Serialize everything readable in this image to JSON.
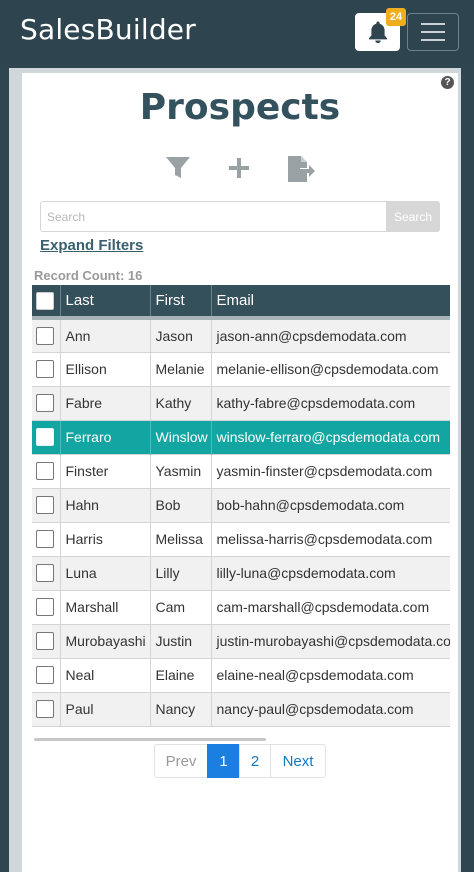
{
  "app": {
    "brand": "SalesBuilder",
    "notification_count": "24"
  },
  "page": {
    "title": "Prospects",
    "help": "?"
  },
  "toolbar": {
    "icons": [
      "filter-icon",
      "plus-icon",
      "export-icon"
    ]
  },
  "search": {
    "placeholder": "Search",
    "value": "",
    "button_label": "Search"
  },
  "filters": {
    "expand_label": "Expand Filters"
  },
  "record_count": "Record Count: 16",
  "table": {
    "columns": [
      "Last",
      "First",
      "Email"
    ],
    "rows": [
      {
        "last": "Ann",
        "first": "Jason",
        "email": "jason-ann@cpsdemodata.com",
        "selected": false
      },
      {
        "last": "Ellison",
        "first": "Melanie",
        "email": "melanie-ellison@cpsdemodata.com",
        "selected": false
      },
      {
        "last": "Fabre",
        "first": "Kathy",
        "email": "kathy-fabre@cpsdemodata.com",
        "selected": false
      },
      {
        "last": "Ferraro",
        "first": "Winslow",
        "email": "winslow-ferraro@cpsdemodata.com",
        "selected": true
      },
      {
        "last": "Finster",
        "first": "Yasmin",
        "email": "yasmin-finster@cpsdemodata.com",
        "selected": false
      },
      {
        "last": "Hahn",
        "first": "Bob",
        "email": "bob-hahn@cpsdemodata.com",
        "selected": false
      },
      {
        "last": "Harris",
        "first": "Melissa",
        "email": "melissa-harris@cpsdemodata.com",
        "selected": false
      },
      {
        "last": "Luna",
        "first": "Lilly",
        "email": "lilly-luna@cpsdemodata.com",
        "selected": false
      },
      {
        "last": "Marshall",
        "first": "Cam",
        "email": "cam-marshall@cpsdemodata.com",
        "selected": false
      },
      {
        "last": "Murobayashi",
        "first": "Justin",
        "email": "justin-murobayashi@cpsdemodata.com",
        "selected": false
      },
      {
        "last": "Neal",
        "first": "Elaine",
        "email": "elaine-neal@cpsdemodata.com",
        "selected": false
      },
      {
        "last": "Paul",
        "first": "Nancy",
        "email": "nancy-paul@cpsdemodata.com",
        "selected": false
      }
    ]
  },
  "pagination": {
    "prev": "Prev",
    "pages": [
      "1",
      "2"
    ],
    "current": "1",
    "next": "Next"
  },
  "colors": {
    "header_bg": "#2e454f",
    "accent_teal": "#13a5a2",
    "title": "#34515e",
    "badge": "#f0ad1e",
    "page_active": "#1a7fe0"
  }
}
